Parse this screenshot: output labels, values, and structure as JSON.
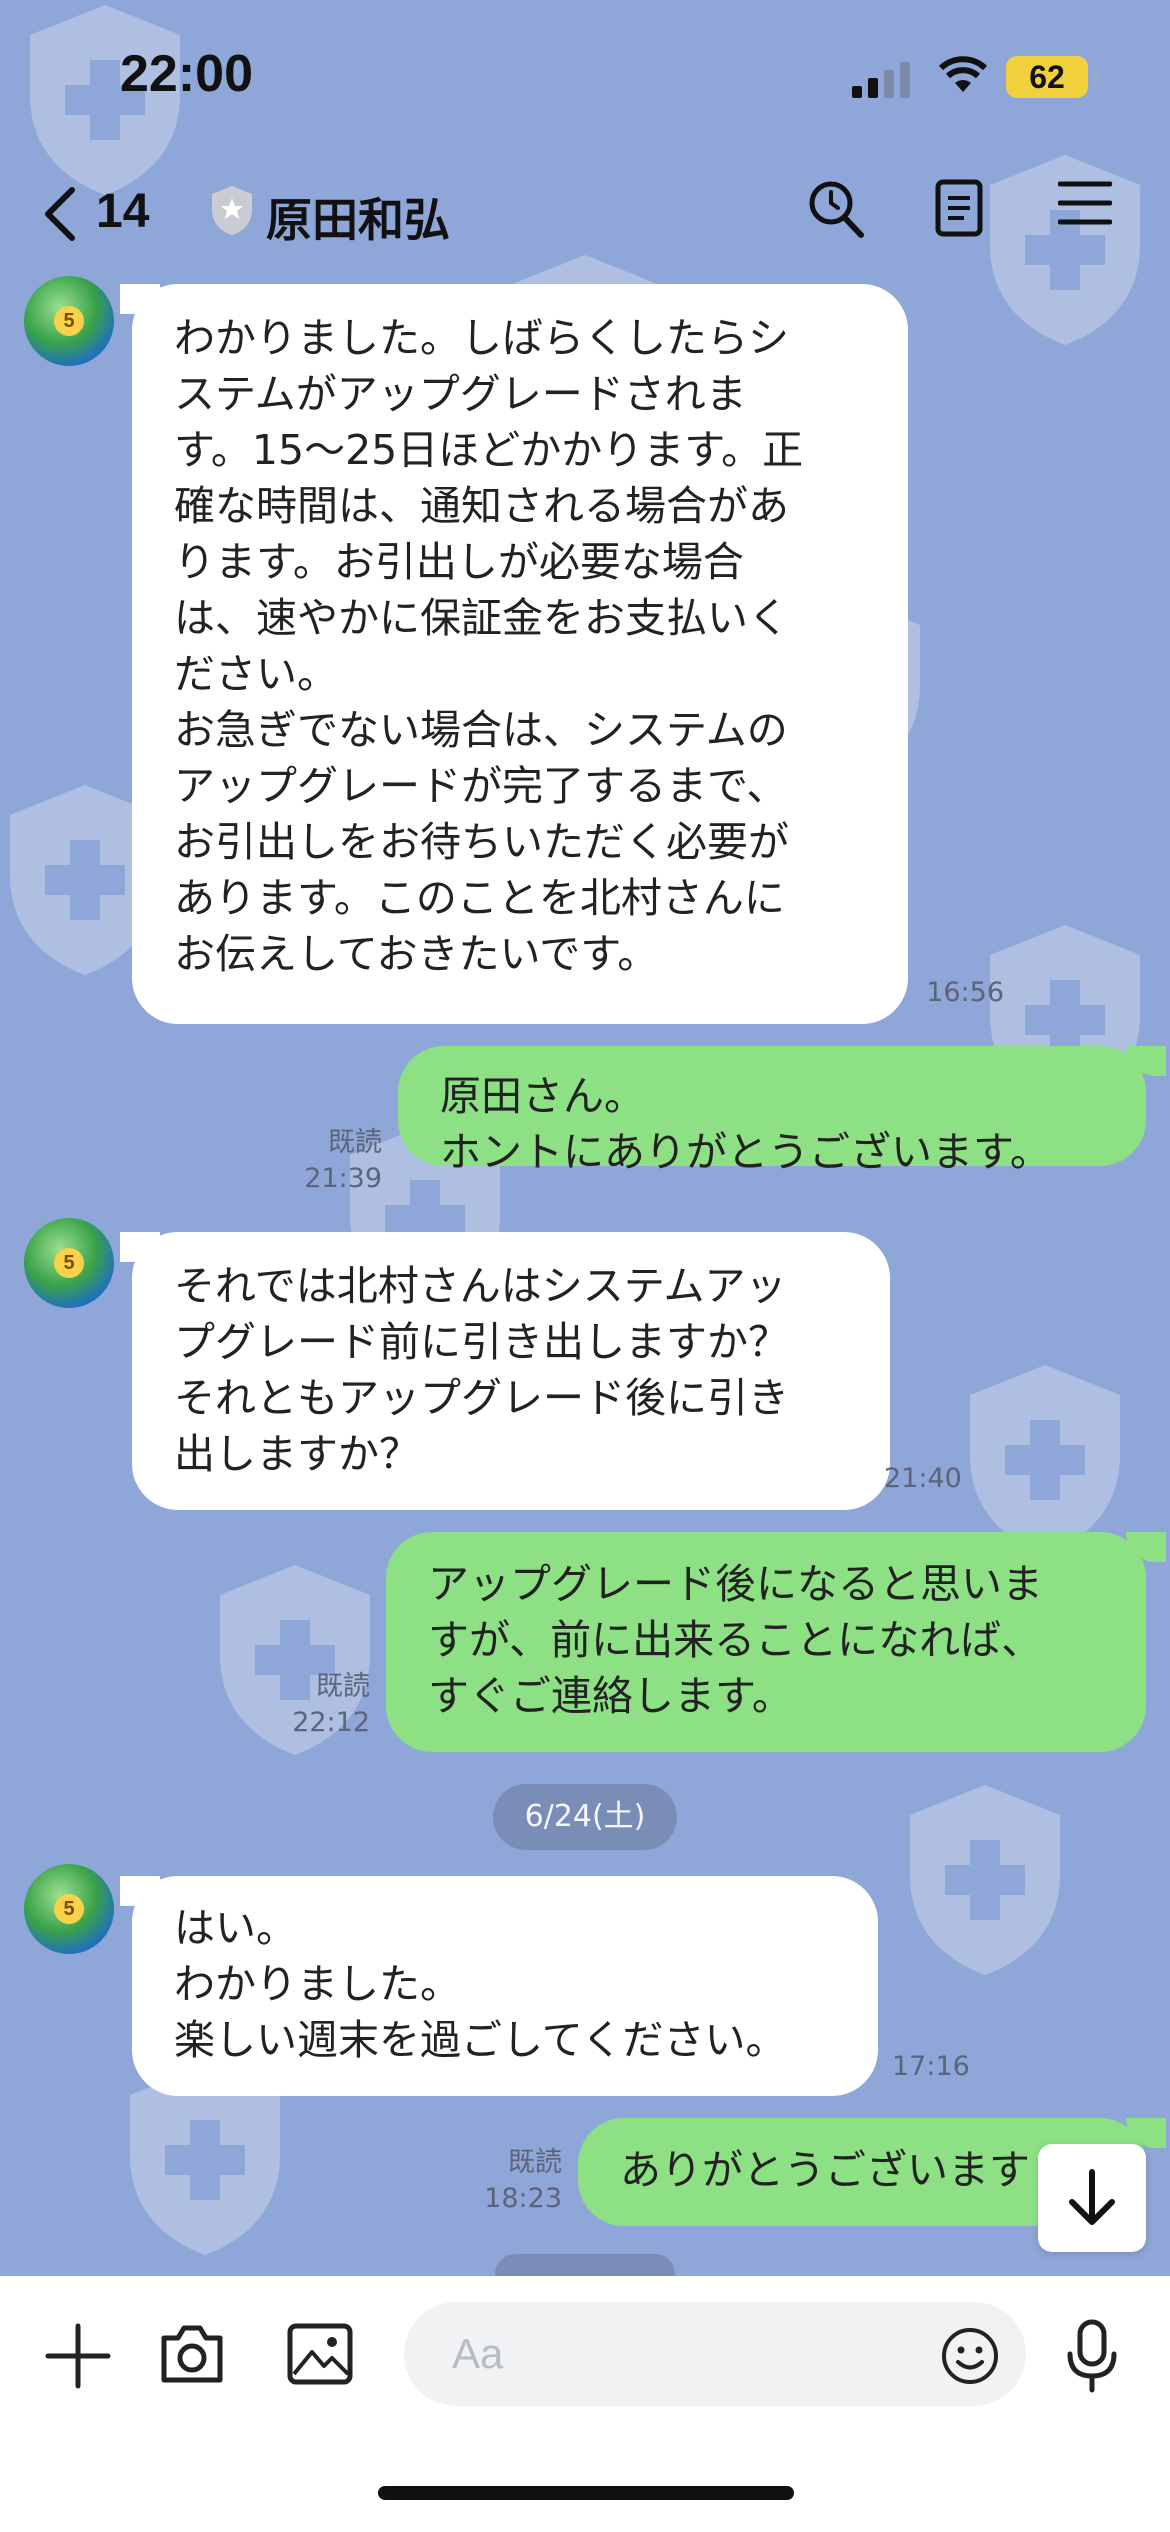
{
  "status_bar": {
    "time": "22:00",
    "battery": "62"
  },
  "header": {
    "back_count": "14",
    "title": "原田和弘"
  },
  "messages": [
    {
      "dir": "in",
      "text": "わかりました。しばらくしたらシ\nステムがアップグレードされま\nす。15〜25日ほどかかります。正\n確な時間は、通知される場合があ\nります。お引出しが必要な場合\nは、速やかに保証金をお支払いく\nださい。\nお急ぎでない場合は、システムの\nアップグレードが完了するまで、\nお引出しをお待ちいただく必要が\nあります。このことを北村さんに\nお伝えしておきたいです。",
      "time": "16:56"
    },
    {
      "dir": "out",
      "text": "原田さん。\nホントにありがとうございます。",
      "read": "既読",
      "time": "21:39"
    },
    {
      "dir": "in",
      "text": "それでは北村さんはシステムアッ\nプグレード前に引き出しますか？\nそれともアップグレード後に引き\n出しますか？",
      "time": "21:40"
    },
    {
      "dir": "out",
      "text": "アップグレード後になると思いま\nすが、前に出来ることになれば、\nすぐご連絡します。",
      "read": "既読",
      "time": "22:12"
    },
    {
      "dir": "in",
      "text": "はい。\nわかりました。\n楽しい週末を過ごしてください。",
      "time": "17:16"
    },
    {
      "dir": "out",
      "text": "ありがとうございます",
      "read": "既読",
      "time": "18:23"
    }
  ],
  "date_separator": "6/24(土)",
  "input": {
    "placeholder": "Aa"
  },
  "colors": {
    "background": "#8fa6d8",
    "outgoing_bubble": "#8de084",
    "incoming_bubble": "#ffffff",
    "battery": "#f0d03c"
  },
  "icons": [
    "back-chevron-icon",
    "verified-badge-icon",
    "search-icon",
    "note-icon",
    "menu-icon",
    "plus-icon",
    "camera-icon",
    "image-icon",
    "emoji-icon",
    "mic-icon",
    "arrow-down-icon"
  ]
}
